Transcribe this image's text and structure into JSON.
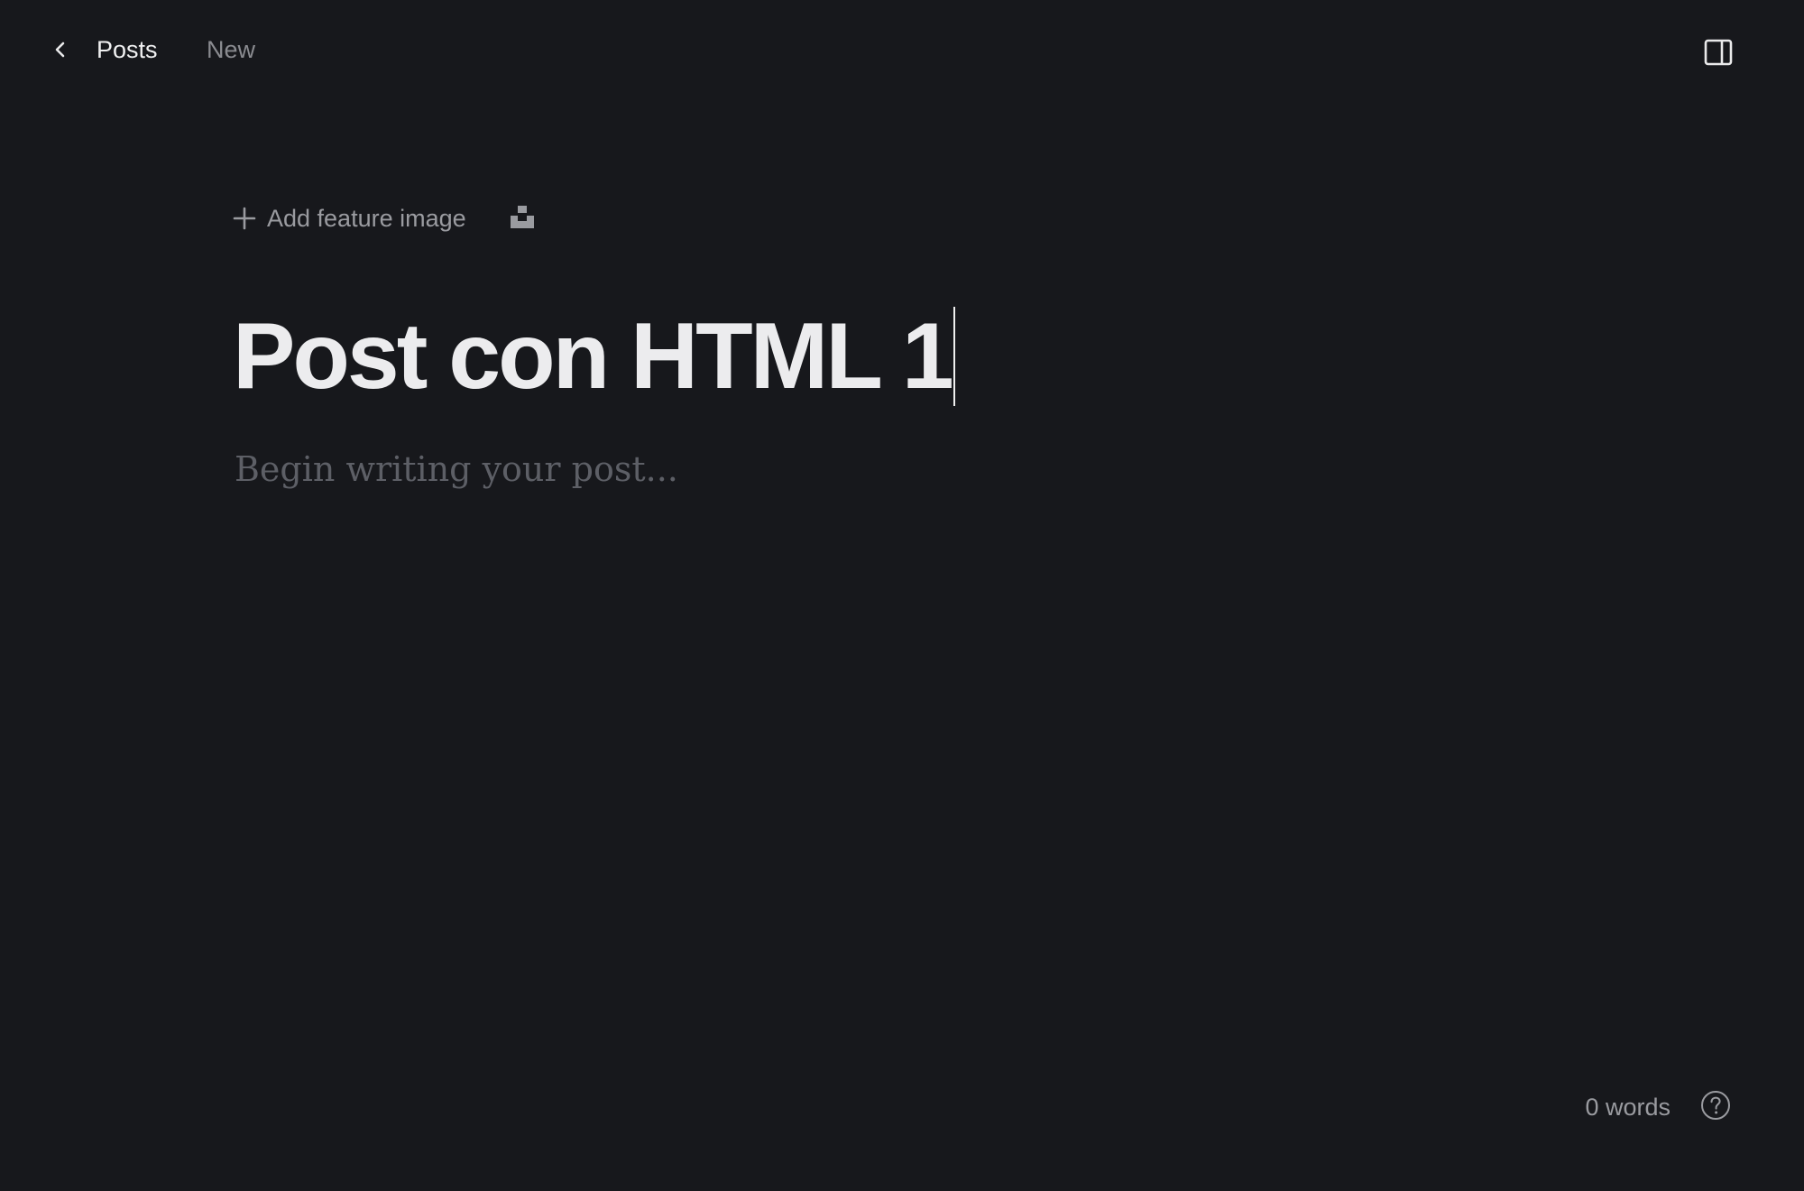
{
  "header": {
    "back_label": "Posts",
    "status": "New"
  },
  "editor": {
    "add_feature_image_label": "Add feature image",
    "title": "Post con HTML 1",
    "body_placeholder": "Begin writing your post..."
  },
  "footer": {
    "word_count": "0 words"
  },
  "icons": {
    "back": "chevron-left-icon",
    "sidebar": "sidebar-toggle-icon",
    "plus": "plus-icon",
    "unsplash": "unsplash-icon",
    "help": "help-circle-icon"
  },
  "colors": {
    "background": "#17181c",
    "title_text": "#ececee",
    "muted_text": "#9a9ba0",
    "placeholder_text": "#5d5f66"
  }
}
